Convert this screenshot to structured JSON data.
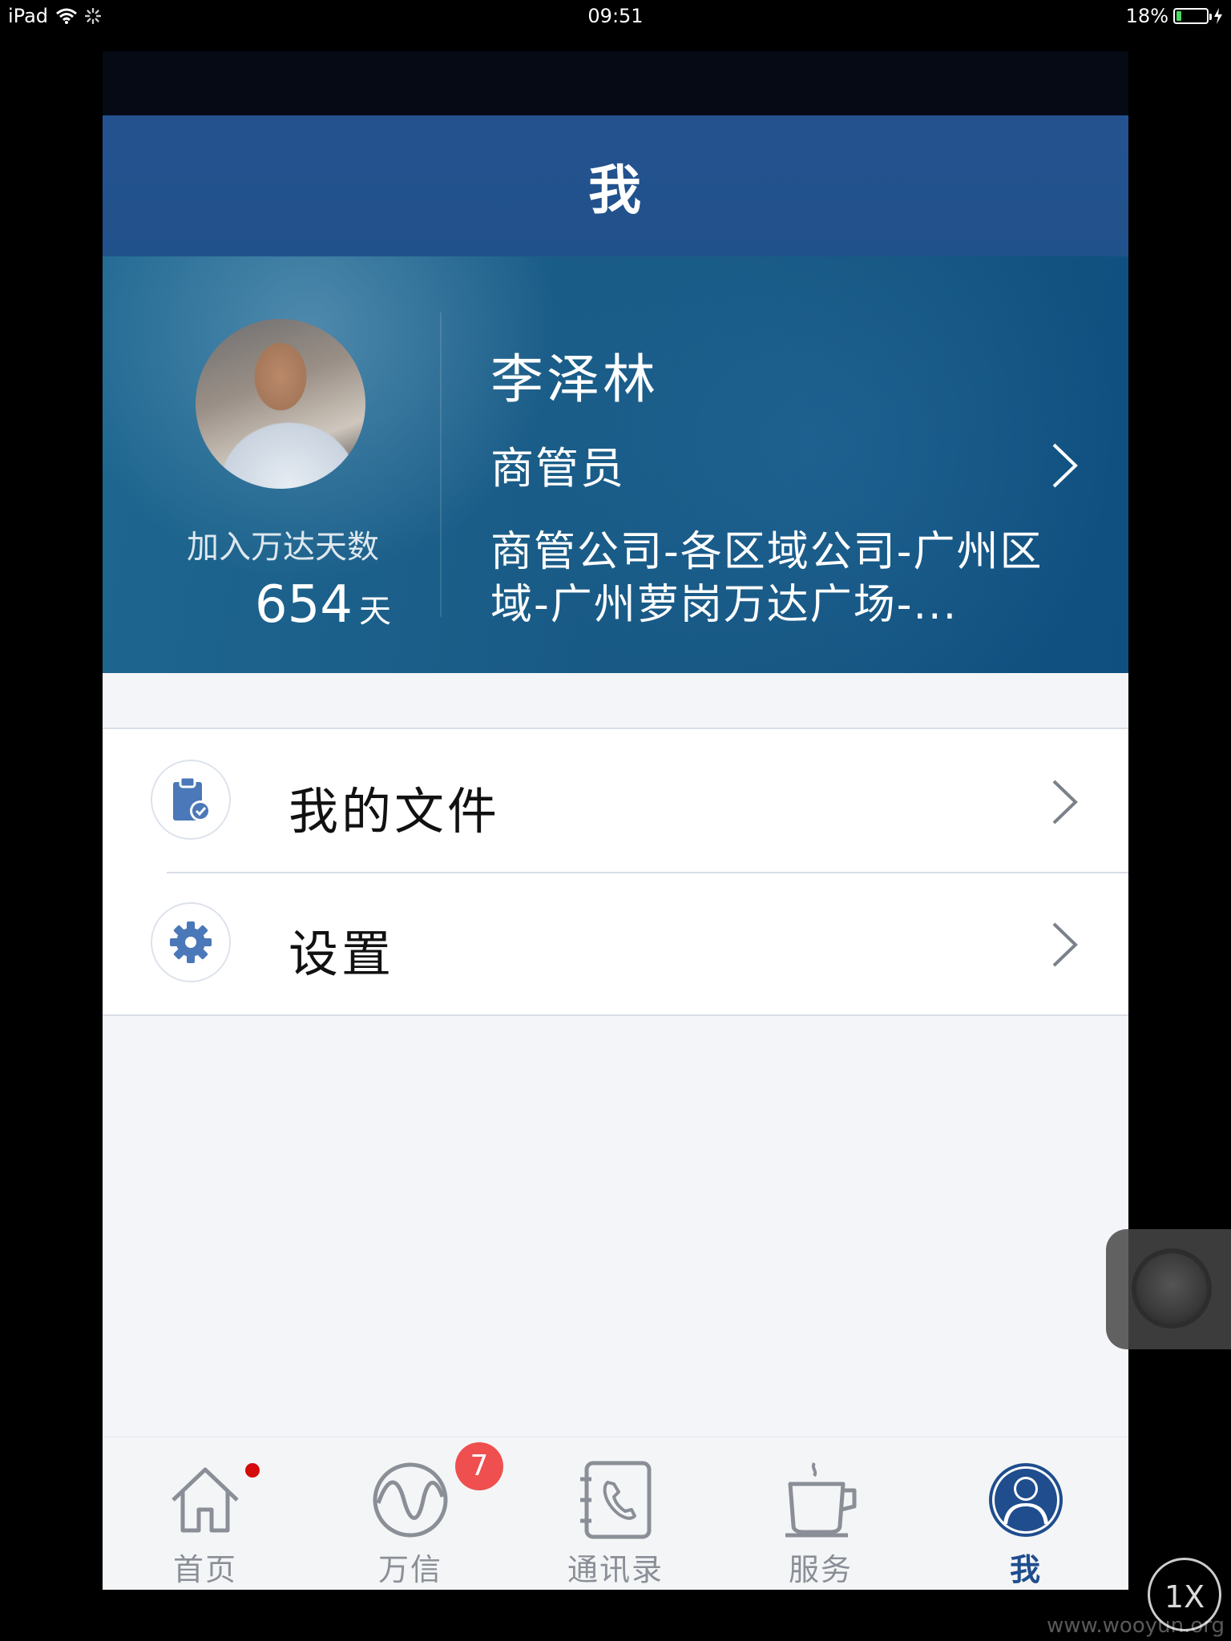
{
  "status_bar": {
    "device": "iPad",
    "time": "09:51",
    "battery": "18%",
    "battery_level": 0.18
  },
  "nav": {
    "title": "我"
  },
  "profile": {
    "join_label": "加入万达天数",
    "join_days": "654",
    "join_unit": "天",
    "name": "李泽林",
    "role": "商管员",
    "department": "商管公司-各区域公司-广州区域-广州萝岗万达广场-..."
  },
  "menu": [
    {
      "label": "我的文件",
      "icon": "clipboard-check-icon"
    },
    {
      "label": "设置",
      "icon": "gear-icon"
    }
  ],
  "tabs": [
    {
      "label": "首页",
      "icon": "home-icon",
      "dot": true
    },
    {
      "label": "万信",
      "icon": "wave-icon",
      "badge": "7"
    },
    {
      "label": "通讯录",
      "icon": "phone-book-icon"
    },
    {
      "label": "服务",
      "icon": "coffee-cup-icon"
    },
    {
      "label": "我",
      "icon": "user-icon",
      "active": true
    }
  ],
  "zoom": "1X",
  "watermark": "www.wooyun.org",
  "colors": {
    "nav": "#23528e",
    "accent": "#1f4d8e",
    "badge": "#ef4f4f",
    "dot": "#d40b0b"
  }
}
